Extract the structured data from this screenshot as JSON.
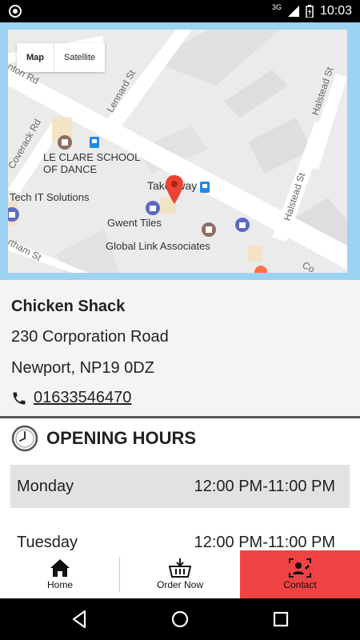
{
  "status_bar": {
    "network": "3G",
    "time": "10:03"
  },
  "map": {
    "type_buttons": [
      "Map",
      "Satellite"
    ],
    "places": {
      "le_clare": "LE CLARE SCHOOL\nOF DANCE",
      "tech_it": "Tech IT Solutions",
      "takeaway": "Takeaway",
      "gwent_tiles": "Gwent Tiles",
      "global_link": "Global Link Associates"
    },
    "streets": {
      "lennard": "Lennard St",
      "halstead": "Halstead St",
      "halstead2": "Halstead St",
      "coverack": "Coverack Rd",
      "clarence": "nton Rd",
      "chatham": "rtham St",
      "corp": "Co"
    },
    "colors": {
      "marker": "#ea4335",
      "border": "#9dd3f2"
    }
  },
  "shop": {
    "name": "Chicken Shack",
    "address_line1": "230 Corporation Road",
    "address_line2": "Newport, NP19 0DZ",
    "phone": "01633546470"
  },
  "hours": {
    "title": "OPENING HOURS",
    "rows": [
      {
        "day": "Monday",
        "time": "12:00 PM-11:00 PM"
      },
      {
        "day": "Tuesday",
        "time": "12:00 PM-11:00 PM"
      }
    ]
  },
  "bottom_nav": {
    "items": [
      {
        "label": "Home",
        "icon": "home-icon"
      },
      {
        "label": "Order Now",
        "icon": "basket-icon"
      },
      {
        "label": "Contact",
        "icon": "contact-icon"
      }
    ],
    "active_color": "#ef4343"
  }
}
